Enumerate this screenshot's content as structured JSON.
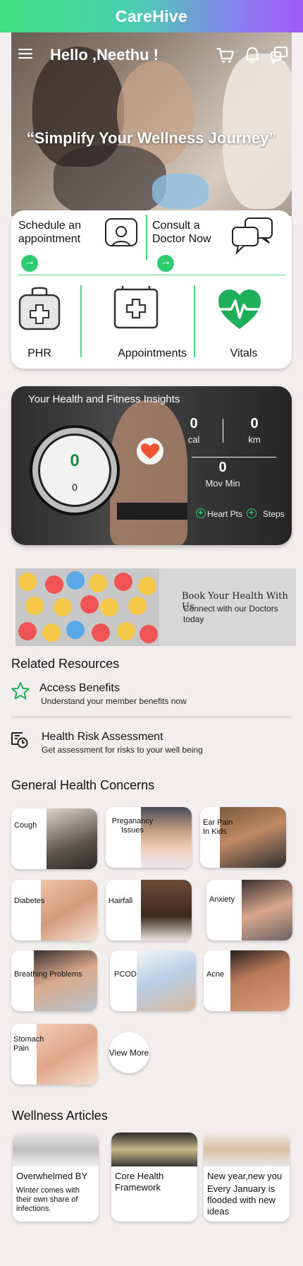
{
  "app": {
    "title": "CareHive"
  },
  "header": {
    "greeting": "Hello ,Neethu !",
    "tagline": "“Simplify Your Wellness Journey”"
  },
  "icons": {
    "menu": "hamburger-menu-icon",
    "cart": "cart-icon",
    "notifications": "bell-icon",
    "chat": "chat-icon"
  },
  "actions": {
    "schedule_label": "Schedule an appointment",
    "consult_label": "Consult a Doctor Now",
    "services": [
      {
        "label": "PHR",
        "icon": "medical-bag-icon"
      },
      {
        "label": "Appointments",
        "icon": "medical-kit-icon"
      },
      {
        "label": "Vitals",
        "icon": "heart-pulse-icon"
      }
    ]
  },
  "insights": {
    "title": "Your Health  and Fitness Insights",
    "ring_top": "0",
    "ring_bottom": "0",
    "cal_value": "0",
    "cal_unit": "cal",
    "km_value": "0",
    "km_unit": "km",
    "mov_value": "0",
    "mov_unit": "Mov Min",
    "legend_heart": "Heart Pts",
    "legend_steps": "Steps"
  },
  "banner": {
    "title": "Book Your Health With Us",
    "subtitle": "Connect with our Doctors today"
  },
  "related": {
    "title": "Related Resources",
    "items": [
      {
        "title": "Access Benefits",
        "subtitle": "Understand your member benefits now",
        "icon": "star-icon"
      },
      {
        "title": "Health Risk Assessment",
        "subtitle": "Get assessment for risks to your well being",
        "icon": "assessment-icon"
      }
    ]
  },
  "concerns": {
    "title": "General Health Concerns",
    "items": [
      {
        "label": "Cough"
      },
      {
        "label": "Preganancy Issues"
      },
      {
        "label": "Ear Pain In Kids"
      },
      {
        "label": "Diabetes"
      },
      {
        "label": "Hairfall"
      },
      {
        "label": "Anxiety"
      },
      {
        "label": "Breathing Problems"
      },
      {
        "label": "PCOD"
      },
      {
        "label": "Acne"
      },
      {
        "label": "Stomach Pain"
      }
    ],
    "view_more": "View More"
  },
  "articles": {
    "title": "Wellness Articles",
    "items": [
      {
        "title": "Overwhelmed BY",
        "summary": "Winter comes with their own share of infections."
      },
      {
        "title": "Core Health Framework",
        "summary": ""
      },
      {
        "title": "New year,new you",
        "summary": "Every January is flooded with new ideas"
      }
    ]
  },
  "colors": {
    "accent": "#2ecc71",
    "divider": "#4ade80",
    "gradient_start": "#3ee081",
    "gradient_end": "#a05cf5"
  }
}
